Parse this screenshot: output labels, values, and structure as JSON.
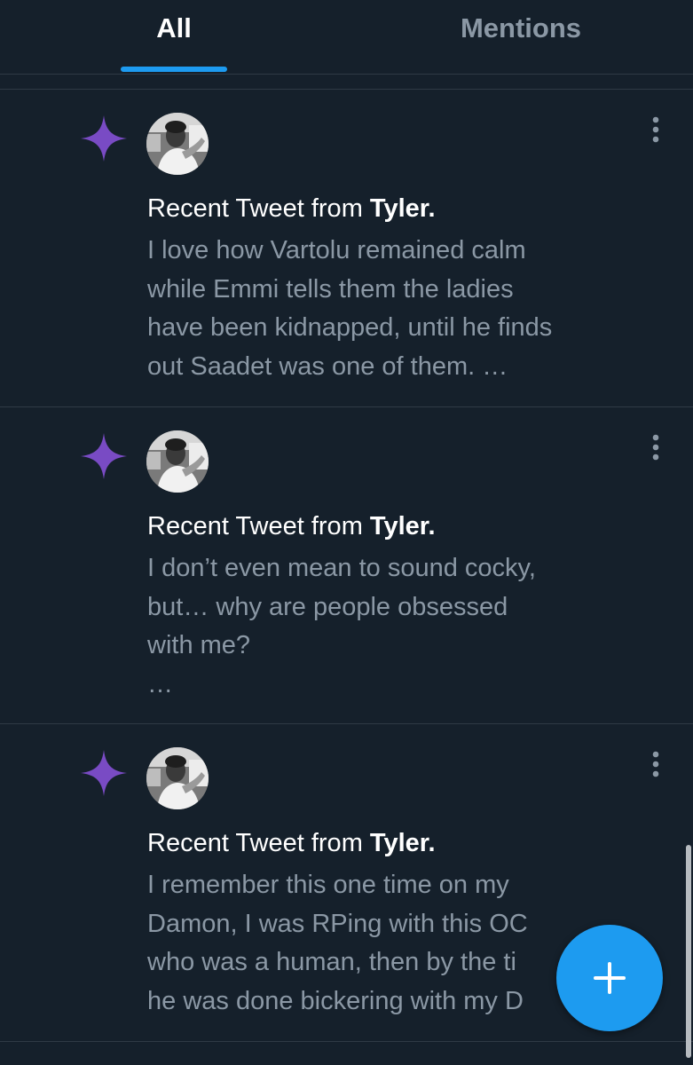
{
  "tabs": [
    {
      "label": "All",
      "selected": true
    },
    {
      "label": "Mentions",
      "selected": false
    }
  ],
  "colors": {
    "background": "#15202b",
    "accent": "#1d9bf0",
    "sparkle": "#794bc4",
    "secondary_text": "#8b98a5",
    "divider": "#2f3a45"
  },
  "notifications": [
    {
      "icon": "sparkle-icon",
      "headline_prefix": "Recent Tweet from ",
      "author": "Tyler.",
      "body_lines": [
        "I love how Vartolu remained calm",
        "while Emmi tells them the ladies",
        "have been kidnapped, until he finds",
        "out Saadet was one of them. …"
      ]
    },
    {
      "icon": "sparkle-icon",
      "headline_prefix": "Recent Tweet from ",
      "author": "Tyler.",
      "body_lines": [
        "I don’t even mean to sound cocky,",
        "but… why are people obsessed",
        "with me?",
        "…"
      ]
    },
    {
      "icon": "sparkle-icon",
      "headline_prefix": "Recent Tweet from ",
      "author": "Tyler.",
      "body_lines": [
        "I remember this one time on my",
        "Damon, I was RPing with this OC",
        "who was a human, then by the ti",
        "he was done bickering with my D"
      ]
    }
  ],
  "fab": {
    "icon": "plus-icon"
  }
}
